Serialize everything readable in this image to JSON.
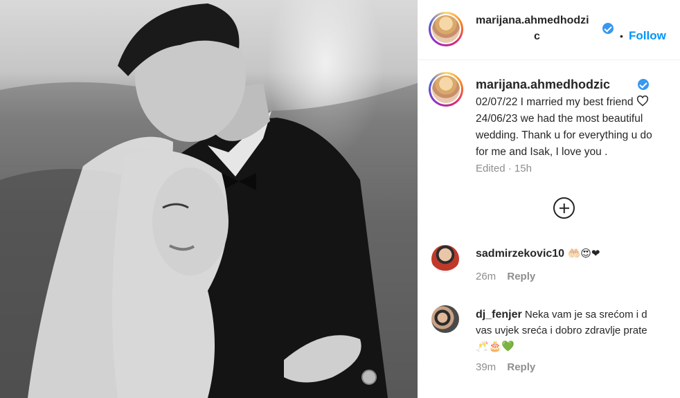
{
  "post": {
    "author": "marijana.ahmedhodzic",
    "author_header_line1": "marijana.ahmedhodzi",
    "author_header_line2": "c",
    "follow_separator": "•",
    "follow_label": "Follow",
    "caption_line1": "02/07/22 I married my best friend",
    "caption_line2": "24/06/23 we had the most beautiful",
    "caption_line3": "wedding. Thank u for everything u do",
    "caption_line4": "for me and Isak, I love you .",
    "edited_label": "Edited",
    "dot": "·",
    "time": "15h"
  },
  "comments": [
    {
      "user": "sadmirzekovic10",
      "text": "",
      "emojis": "🤲🏻😍❤",
      "time": "26m",
      "reply_label": "Reply"
    },
    {
      "user": "dj_fenjer",
      "text_line1": "Neka vam je sa srećom i d",
      "text_line2": "vas uvjek sreća i dobro zdravlje prate",
      "emojis": "🥂🎂💚",
      "time": "39m",
      "reply_label": "Reply"
    }
  ],
  "colors": {
    "follow": "#0095f6",
    "verified": "#3897f0",
    "muted": "#8e8e8e",
    "text": "#262626"
  },
  "icons": {
    "verified": "verified-badge-icon",
    "heart": "heart-outline-icon",
    "load_more": "plus-circle-icon"
  }
}
